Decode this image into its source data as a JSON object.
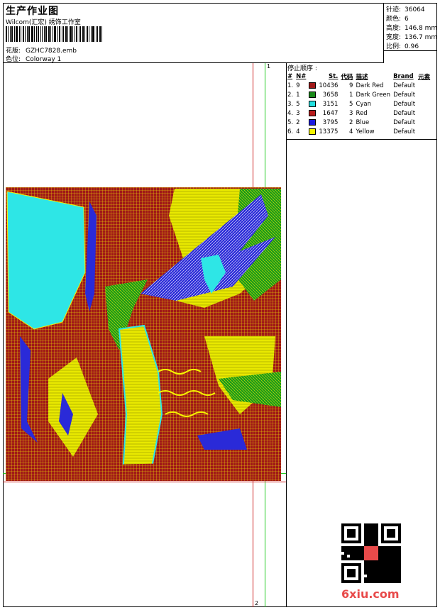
{
  "header": {
    "title": "生产作业图",
    "company": "Wilcom(汇宏) 绣饰工作室",
    "design_label": "花版:",
    "design_value": "GZHC7828.emb",
    "colorway_label": "色位:",
    "colorway_value": "Colorway 1"
  },
  "stats": {
    "stitches_label": "针迹:",
    "stitches_value": "36064",
    "colors_label": "颜色:",
    "colors_value": "6",
    "height_label": "高度:",
    "height_value": "146.8 mm",
    "width_label": "宽度:",
    "width_value": "136.7 mm",
    "scale_label": "比例:",
    "scale_value": "0.96"
  },
  "stop_sequence": {
    "title": "停止顺序 :",
    "headers": [
      "#",
      "N#",
      "St.",
      "代码",
      "描述",
      "Brand",
      "元素"
    ],
    "rows": [
      {
        "idx": "1.",
        "n": "9",
        "color": "#a01818",
        "st": "10436",
        "code": "9",
        "desc": "Dark Red",
        "brand": "Default"
      },
      {
        "idx": "2.",
        "n": "1",
        "color": "#1a8a1a",
        "st": "3658",
        "code": "1",
        "desc": "Dark Green",
        "brand": "Default"
      },
      {
        "idx": "3.",
        "n": "5",
        "color": "#22e0e0",
        "st": "3151",
        "code": "5",
        "desc": "Cyan",
        "brand": "Default"
      },
      {
        "idx": "4.",
        "n": "3",
        "color": "#b81c1c",
        "st": "1647",
        "code": "3",
        "desc": "Red",
        "brand": "Default"
      },
      {
        "idx": "5.",
        "n": "2",
        "color": "#1a1ae0",
        "st": "3795",
        "code": "2",
        "desc": "Blue",
        "brand": "Default"
      },
      {
        "idx": "6.",
        "n": "4",
        "color": "#f5f500",
        "st": "13375",
        "code": "4",
        "desc": "Yellow",
        "brand": "Default"
      }
    ]
  },
  "guides": {
    "top_label": "1",
    "left_label": "1",
    "bottom_label": "2"
  },
  "watermark": "6xiu.com",
  "colors": {
    "guide_green": "#22cc22",
    "guide_red": "#cc2222"
  }
}
